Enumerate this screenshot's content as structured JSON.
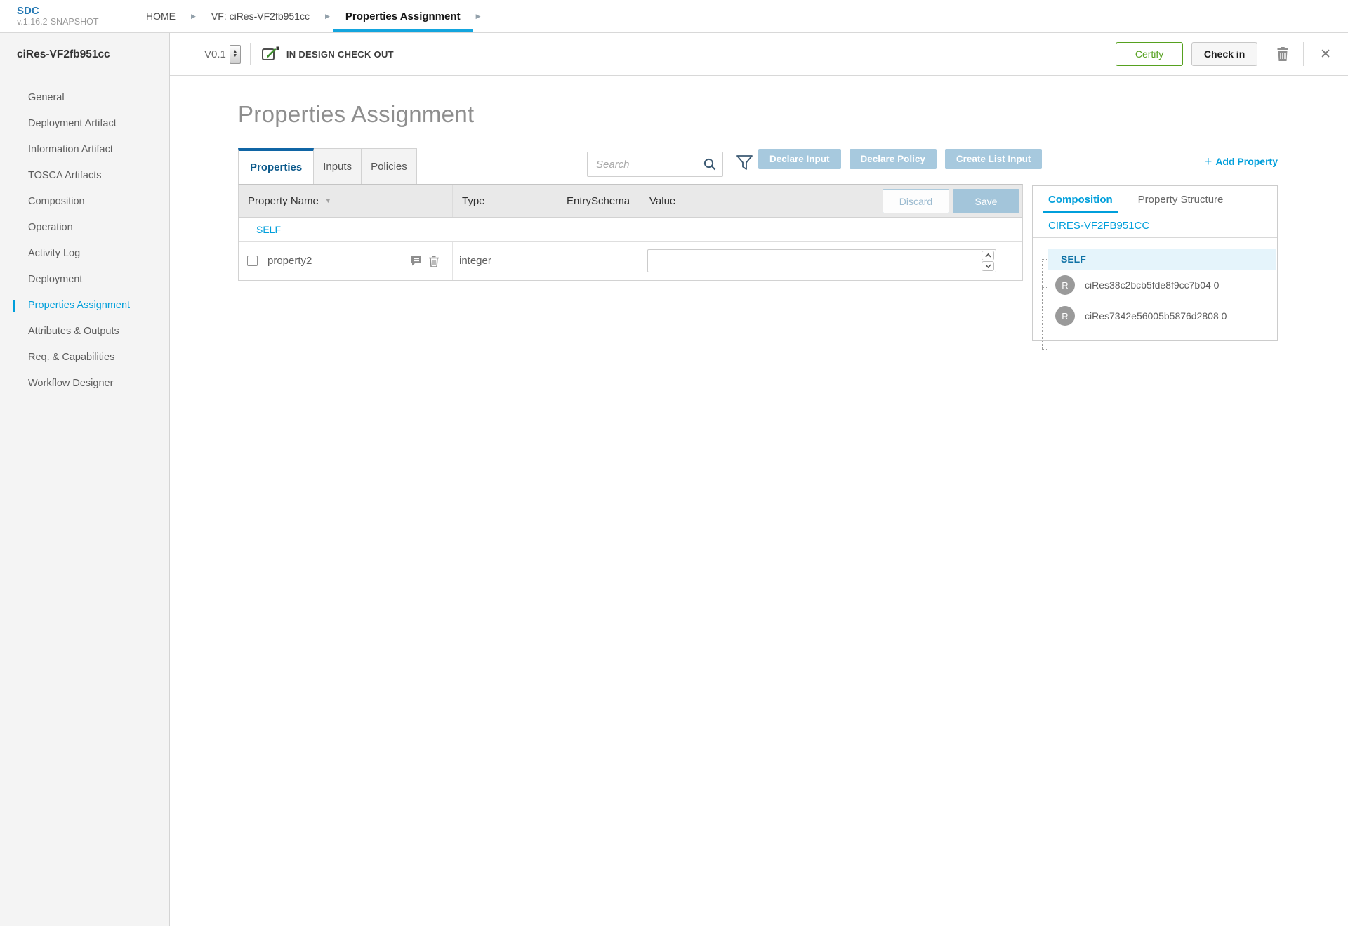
{
  "header": {
    "logo_title": "SDC",
    "logo_version": "v.1.16.2-SNAPSHOT",
    "breadcrumbs": [
      {
        "label": "HOME"
      },
      {
        "label": "VF: ciRes-VF2fb951cc"
      },
      {
        "label": "Properties Assignment"
      }
    ]
  },
  "toolbar": {
    "version": "V0.1",
    "status": "IN DESIGN CHECK OUT",
    "certify_label": "Certify",
    "checkin_label": "Check in"
  },
  "sidebar": {
    "title": "ciRes-VF2fb951cc",
    "items": [
      {
        "label": "General"
      },
      {
        "label": "Deployment Artifact"
      },
      {
        "label": "Information Artifact"
      },
      {
        "label": "TOSCA Artifacts"
      },
      {
        "label": "Composition"
      },
      {
        "label": "Operation"
      },
      {
        "label": "Activity Log"
      },
      {
        "label": "Deployment"
      },
      {
        "label": "Properties Assignment"
      },
      {
        "label": "Attributes & Outputs"
      },
      {
        "label": "Req. & Capabilities"
      },
      {
        "label": "Workflow Designer"
      }
    ],
    "active_item": "Properties Assignment"
  },
  "main": {
    "title": "Properties Assignment",
    "tabs": [
      {
        "label": "Properties"
      },
      {
        "label": "Inputs"
      },
      {
        "label": "Policies"
      }
    ],
    "active_tab": "Properties",
    "search_placeholder": "Search",
    "actions": [
      {
        "label": "Declare Input"
      },
      {
        "label": "Declare Policy"
      },
      {
        "label": "Create List Input"
      }
    ],
    "add_property_plus": "+",
    "add_property_label": "Add Property",
    "table": {
      "columns": [
        "Property Name",
        "Type",
        "EntrySchema",
        "Value"
      ],
      "sort_caret": "▼",
      "discard_label": "Discard",
      "save_label": "Save",
      "group_label": "SELF",
      "rows": [
        {
          "name": "property2",
          "type": "integer",
          "entry_schema": "",
          "value": "",
          "checked": false
        }
      ]
    }
  },
  "right_panel": {
    "tabs": [
      {
        "label": "Composition"
      },
      {
        "label": "Property Structure"
      }
    ],
    "active_tab": "Composition",
    "component_title": "CIRES-VF2FB951CC",
    "tree": {
      "root": "SELF",
      "children": [
        {
          "avatar": "R",
          "label": "ciRes38c2bcb5fde8f9cc7b04 0"
        },
        {
          "avatar": "R",
          "label": "ciRes7342e56005b5876d2808 0"
        }
      ]
    }
  },
  "colors": {
    "accent_blue": "#009fdb",
    "breadcrumb_underline": "#13a5de",
    "tab_active_border": "#1065a5",
    "action_button_blue": "#a7c9de",
    "certify_green": "#56a11f"
  },
  "glyphs": {
    "close": "✕",
    "crumb_arrow": "▶",
    "stepper_up": "▲",
    "stepper_down": "▼"
  }
}
